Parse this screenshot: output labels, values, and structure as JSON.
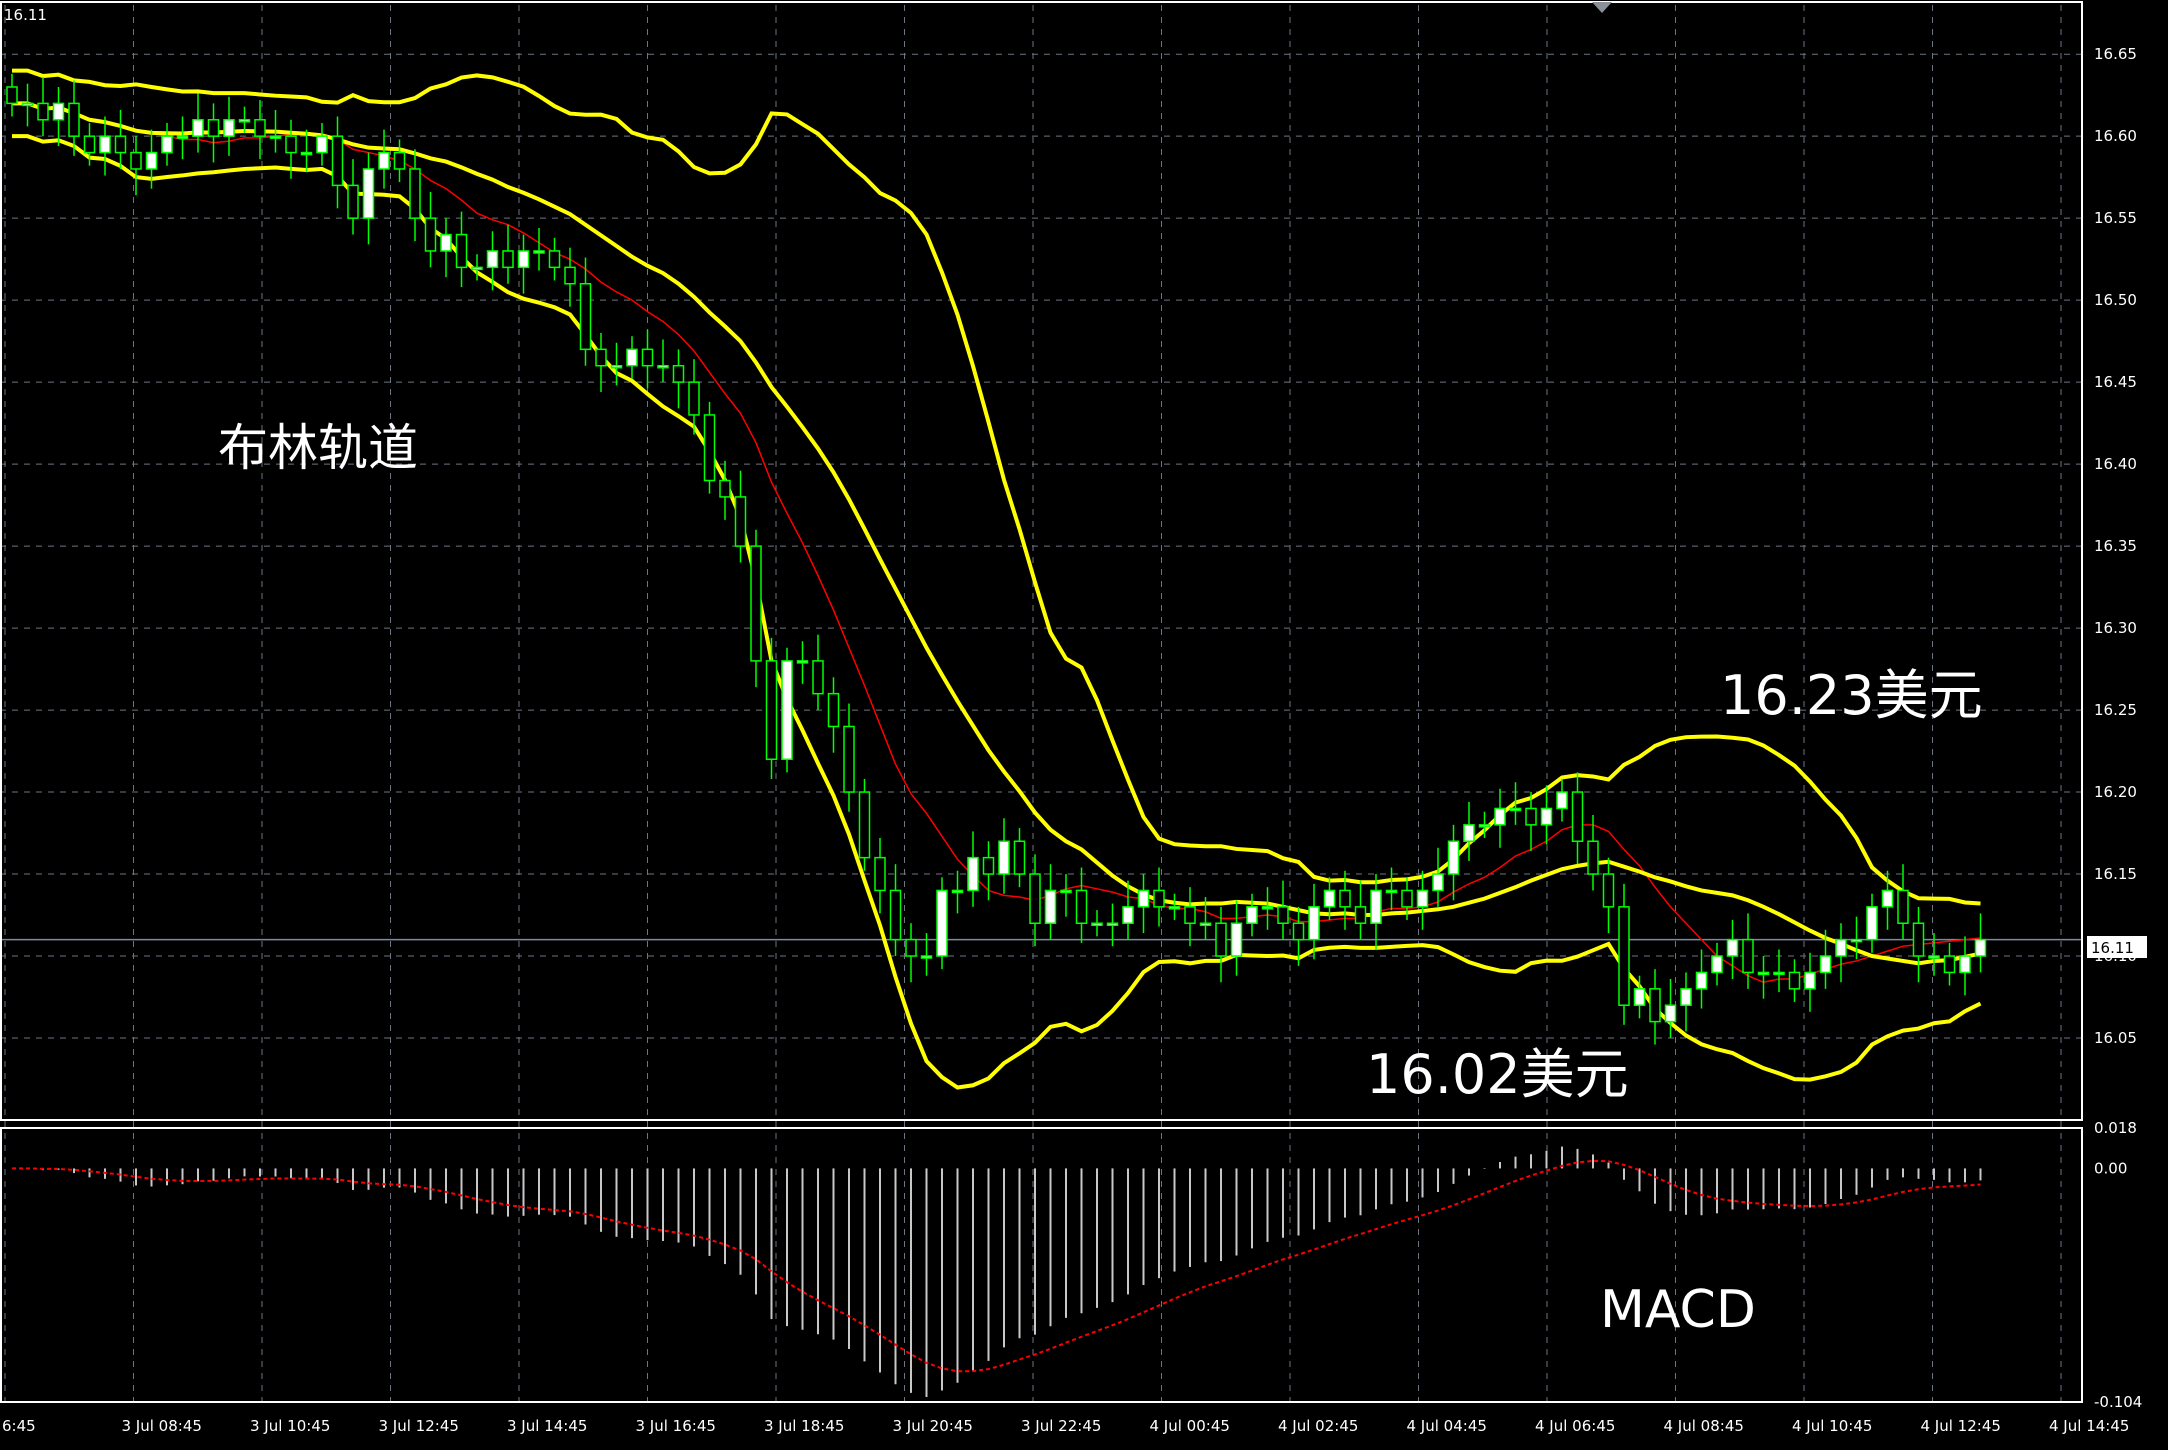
{
  "chart_data": [
    {
      "type": "candlestick",
      "symbol_price_label": "16.11",
      "ylim": [
        16.0,
        16.68
      ],
      "y_ticks": [
        "16.65",
        "16.60",
        "16.55",
        "16.50",
        "16.45",
        "16.40",
        "16.35",
        "16.30",
        "16.25",
        "16.20",
        "16.15",
        "16.10",
        "16.05"
      ],
      "current_price": "16.11",
      "x_ticks": [
        "6:45",
        "3 Jul 08:45",
        "3 Jul 10:45",
        "3 Jul 12:45",
        "3 Jul 14:45",
        "3 Jul 16:45",
        "3 Jul 18:45",
        "3 Jul 20:45",
        "3 Jul 22:45",
        "4 Jul 00:45",
        "4 Jul 02:45",
        "4 Jul 04:45",
        "4 Jul 06:45",
        "4 Jul 08:45",
        "4 Jul 10:45",
        "4 Jul 12:45",
        "4 Jul 14:45"
      ],
      "close": [
        16.62,
        16.62,
        16.61,
        16.62,
        16.6,
        16.59,
        16.6,
        16.59,
        16.58,
        16.59,
        16.6,
        16.6,
        16.61,
        16.6,
        16.61,
        16.61,
        16.6,
        16.6,
        16.59,
        16.59,
        16.6,
        16.57,
        16.55,
        16.58,
        16.59,
        16.58,
        16.55,
        16.53,
        16.54,
        16.52,
        16.52,
        16.53,
        16.52,
        16.53,
        16.53,
        16.52,
        16.51,
        16.47,
        16.46,
        16.46,
        16.47,
        16.46,
        16.46,
        16.45,
        16.43,
        16.39,
        16.38,
        16.35,
        16.28,
        16.22,
        16.28,
        16.28,
        16.26,
        16.24,
        16.2,
        16.16,
        16.14,
        16.11,
        16.1,
        16.1,
        16.14,
        16.14,
        16.16,
        16.15,
        16.17,
        16.15,
        16.12,
        16.14,
        16.14,
        16.12,
        16.12,
        16.12,
        16.13,
        16.14,
        16.13,
        16.13,
        16.12,
        16.12,
        16.1,
        16.12,
        16.13,
        16.13,
        16.12,
        16.11,
        16.13,
        16.14,
        16.13,
        16.12,
        16.14,
        16.14,
        16.13,
        16.14,
        16.15,
        16.17,
        16.18,
        16.18,
        16.19,
        16.19,
        16.18,
        16.19,
        16.2,
        16.17,
        16.15,
        16.13,
        16.07,
        16.08,
        16.06,
        16.07,
        16.08,
        16.09,
        16.1,
        16.11,
        16.09,
        16.09,
        16.09,
        16.08,
        16.09,
        16.1,
        16.11,
        16.11,
        16.13,
        16.14,
        16.12,
        16.1,
        16.1,
        16.09,
        16.1,
        16.11
      ],
      "bollinger_upper_label": "16.23美元",
      "bollinger_lower_label": "16.02美元",
      "bollinger_title": "布林轨道"
    },
    {
      "type": "histogram",
      "title": "MACD",
      "ylim": [
        -0.104,
        0.018
      ],
      "y_ticks": [
        "0.018",
        "0.00",
        "-0.104"
      ]
    }
  ],
  "colors": {
    "background": "#000000",
    "grid": "#6e7580",
    "candle": "#00ff00",
    "candle_body": "#ffffff",
    "bollinger": "#ffff00",
    "ma": "#ff0000",
    "macd_hist": "#c8c8c8",
    "macd_signal": "#ff0000",
    "price_line": "#7a8aa8"
  }
}
